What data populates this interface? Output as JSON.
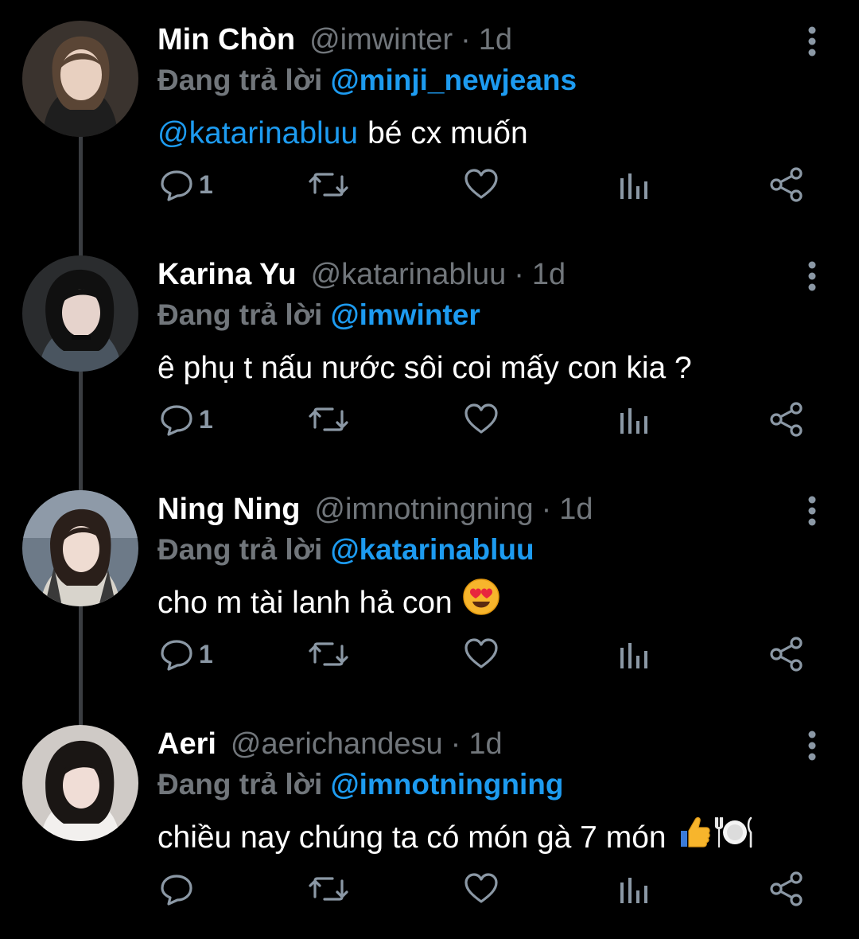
{
  "colors": {
    "background": "#000000",
    "text": "#ffffff",
    "muted": "#71767b",
    "link": "#1d9bf0",
    "icon": "#8b98a5",
    "thread_line": "#3a3d41"
  },
  "replying_label": "Đang trả lời",
  "tweets": [
    {
      "name": "Min Chòn",
      "handle": "@imwinter",
      "dot": "·",
      "time": "1d",
      "replying_to": "@minji_newjeans",
      "mention": "@katarinabluu",
      "text": "bé cx muốn",
      "emojis": [],
      "reply_count": "1",
      "icons": [
        "reply-icon",
        "retweet-icon",
        "like-icon",
        "views-icon",
        "share-icon",
        "more-icon"
      ]
    },
    {
      "name": "Karina Yu",
      "handle": "@katarinabluu",
      "dot": "·",
      "time": "1d",
      "replying_to": "@imwinter",
      "mention": "",
      "text": "ê phụ t nấu nước sôi coi mấy con kia ?",
      "emojis": [],
      "reply_count": "1",
      "icons": [
        "reply-icon",
        "retweet-icon",
        "like-icon",
        "views-icon",
        "share-icon",
        "more-icon"
      ]
    },
    {
      "name": "Ning Ning",
      "handle": "@imnotningning",
      "dot": "·",
      "time": "1d",
      "replying_to": "@katarinabluu",
      "mention": "",
      "text": "cho m tài lanh hả con",
      "emojis": [
        "heart-eyes-emoji"
      ],
      "reply_count": "1",
      "icons": [
        "reply-icon",
        "retweet-icon",
        "like-icon",
        "views-icon",
        "share-icon",
        "more-icon"
      ]
    },
    {
      "name": "Aeri",
      "handle": "@aerichandesu",
      "dot": "·",
      "time": "1d",
      "replying_to": "@imnotningning",
      "mention": "",
      "text": "chiều nay chúng ta có món gà 7 món",
      "emojis": [
        "thumbs-up-emoji",
        "plate-cutlery-emoji"
      ],
      "reply_count": "",
      "icons": [
        "reply-icon",
        "retweet-icon",
        "like-icon",
        "views-icon",
        "share-icon",
        "more-icon"
      ]
    }
  ]
}
